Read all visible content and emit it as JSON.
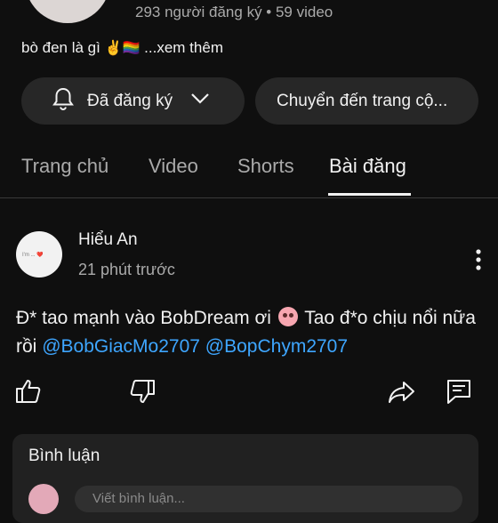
{
  "channel": {
    "stats": "293 người đăng ký • 59 video",
    "description": "bò đen là gì",
    "description_emojis": "✌️🏳️‍🌈",
    "more_label": "...xem thêm"
  },
  "actions": {
    "subscribed_label": "Đã đăng ký",
    "go_to_label": "Chuyển đến trang cộ..."
  },
  "tabs": [
    {
      "label": "Trang chủ"
    },
    {
      "label": "Video"
    },
    {
      "label": "Shorts"
    },
    {
      "label": "Bài đăng"
    }
  ],
  "active_tab": "Bài đăng",
  "post": {
    "author": "Hiểu An",
    "time": "21 phút trước",
    "avatar_caption": "I'm ... ❤️",
    "text_part1": "Đ* tao mạnh vào BobDream ơi",
    "text_part2": "Tao đ*o chịu nổi nữa rồi",
    "mention1": "@BobGiacMo2707",
    "mention2": "@BopChym2707"
  },
  "comments": {
    "label": "Bình luận",
    "placeholder": "Viết bình luận..."
  },
  "colors": {
    "background": "#0f0f0f",
    "pill": "#272727",
    "mention": "#3ea6ff",
    "muted_text": "#aaaaaa"
  },
  "icons": [
    "bell-icon",
    "chevron-down-icon",
    "more-vert-icon",
    "like-icon",
    "dislike-icon",
    "share-icon",
    "comment-icon"
  ]
}
